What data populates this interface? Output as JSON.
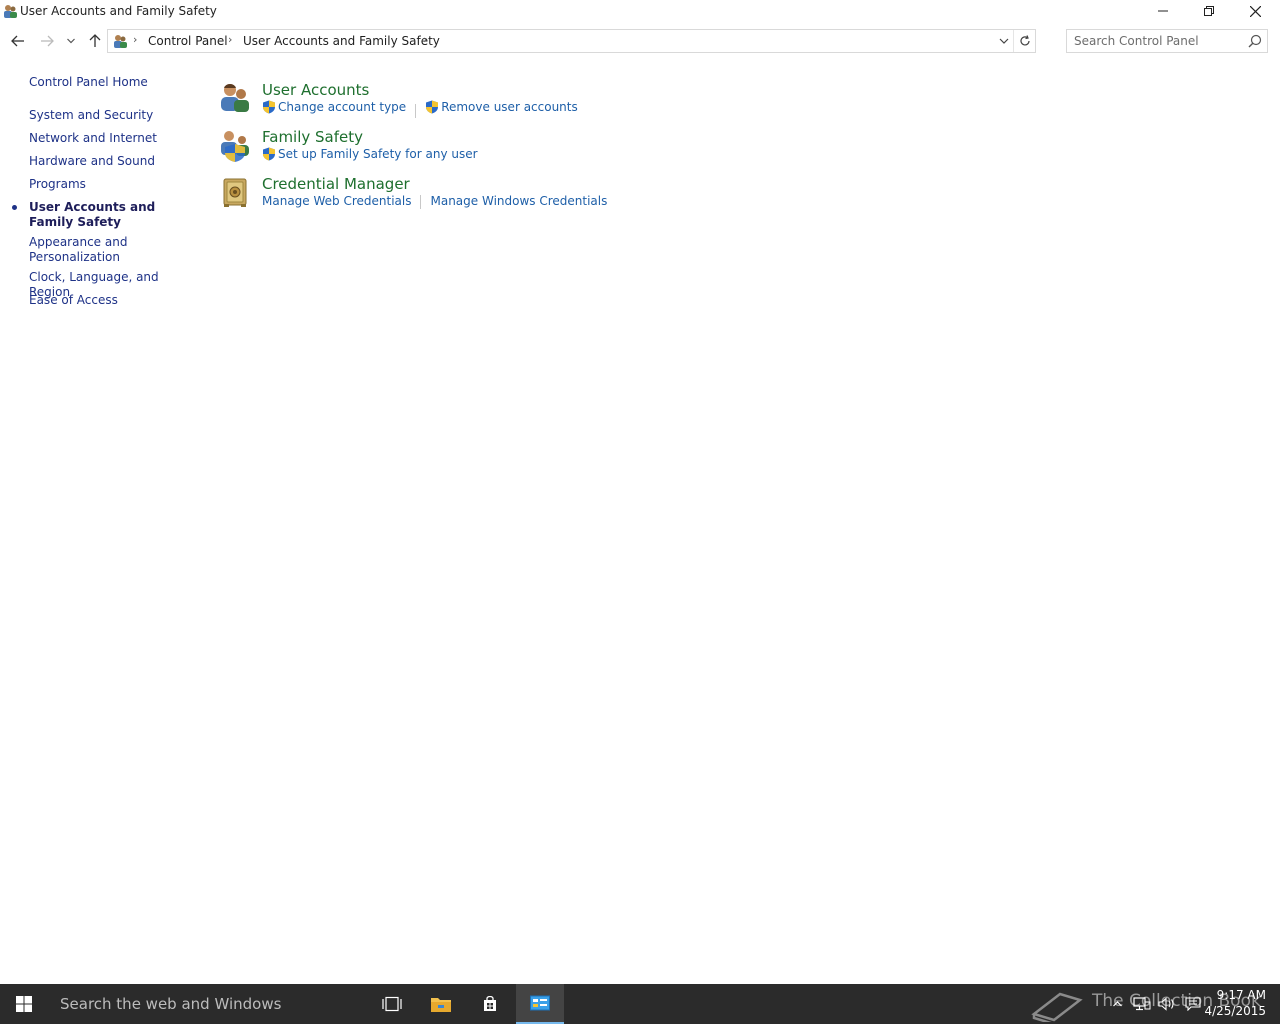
{
  "window": {
    "title": "User Accounts and Family Safety"
  },
  "address_bar": {
    "breadcrumbs": [
      "Control Panel",
      "User Accounts and Family Safety"
    ]
  },
  "search": {
    "placeholder": "Search Control Panel"
  },
  "sidebar": {
    "items": [
      {
        "label": "Control Panel Home",
        "active": false
      },
      {
        "label": "System and Security",
        "active": false
      },
      {
        "label": "Network and Internet",
        "active": false
      },
      {
        "label": "Hardware and Sound",
        "active": false
      },
      {
        "label": "Programs",
        "active": false
      },
      {
        "label": "User Accounts and Family Safety",
        "active": true
      },
      {
        "label": "Appearance and Personalization",
        "active": false
      },
      {
        "label": "Clock, Language, and Region",
        "active": false
      },
      {
        "label": "Ease of Access",
        "active": false
      }
    ]
  },
  "categories": [
    {
      "title": "User Accounts",
      "icon": "user-accounts-icon",
      "links": [
        {
          "label": "Change account type",
          "shield": true
        },
        {
          "label": "Remove user accounts",
          "shield": true
        }
      ]
    },
    {
      "title": "Family Safety",
      "icon": "family-safety-icon",
      "links": [
        {
          "label": "Set up Family Safety for any user",
          "shield": true
        }
      ]
    },
    {
      "title": "Credential Manager",
      "icon": "credential-manager-icon",
      "links": [
        {
          "label": "Manage Web Credentials",
          "shield": false
        },
        {
          "label": "Manage Windows Credentials",
          "shield": false
        }
      ]
    }
  ],
  "taskbar": {
    "search_placeholder": "Search the web and Windows",
    "watermark": "The Collection Book",
    "time": "9:17 AM",
    "date": "4/25/2015"
  },
  "colors": {
    "link": "#1e5fa8",
    "category_title": "#1e6f2e",
    "nav": "#1e3287",
    "taskbar": "#2b2b2b"
  }
}
